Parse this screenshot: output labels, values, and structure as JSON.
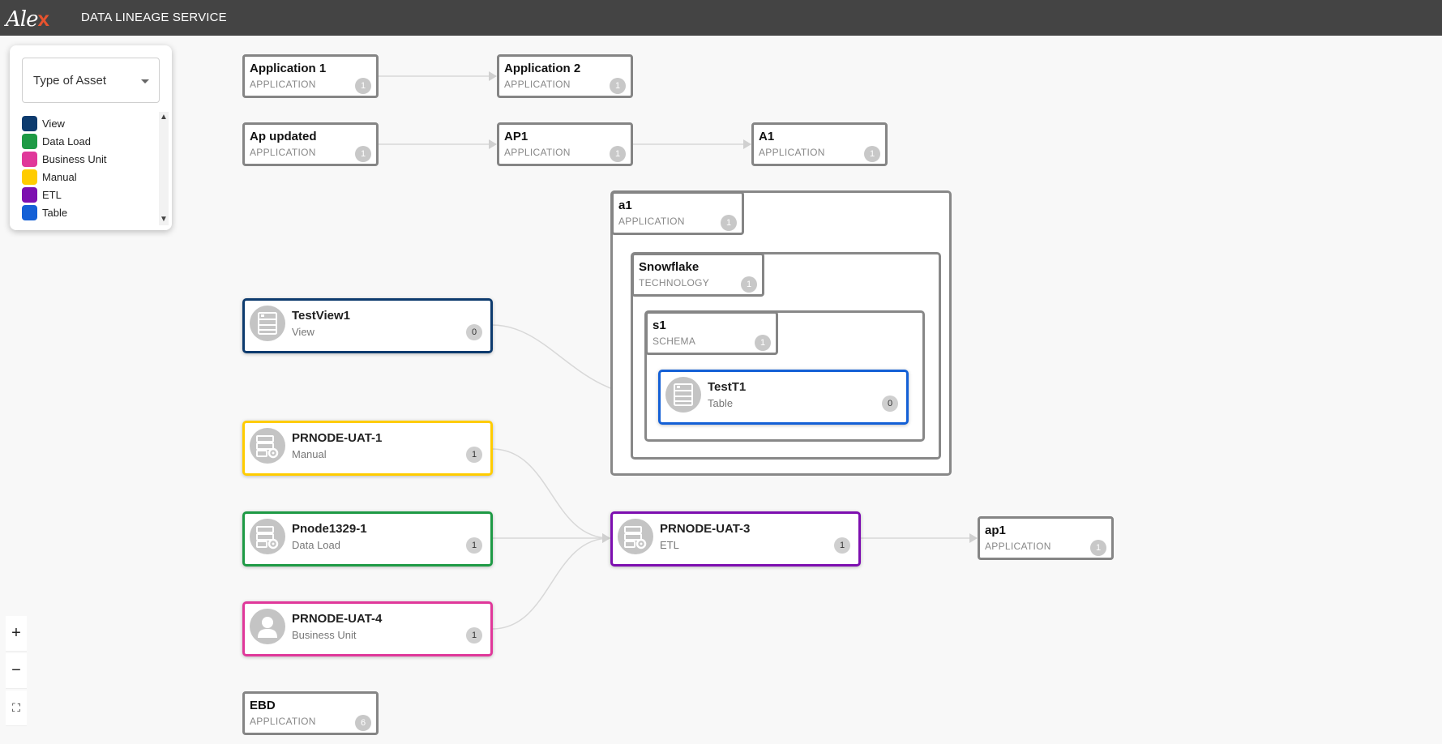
{
  "header": {
    "logo_text": "Ale",
    "logo_accent": "x",
    "title": "DATA LINEAGE SERVICE"
  },
  "legend": {
    "select_label": "Type of Asset",
    "items": [
      {
        "label": "View",
        "color": "#0d3b6e"
      },
      {
        "label": "Data Load",
        "color": "#1e9a45"
      },
      {
        "label": "Business Unit",
        "color": "#e0389a"
      },
      {
        "label": "Manual",
        "color": "#ffcc00"
      },
      {
        "label": "ETL",
        "color": "#7d0fb0"
      },
      {
        "label": "Table",
        "color": "#1460d6"
      }
    ]
  },
  "nodes": {
    "app1": {
      "title": "Application 1",
      "type": "APPLICATION",
      "count": "1"
    },
    "app2": {
      "title": "Application 2",
      "type": "APPLICATION",
      "count": "1"
    },
    "apupdated": {
      "title": "Ap updated",
      "type": "APPLICATION",
      "count": "1"
    },
    "ap1upper": {
      "title": "AP1",
      "type": "APPLICATION",
      "count": "1"
    },
    "a1upper": {
      "title": "A1",
      "type": "APPLICATION",
      "count": "1"
    },
    "a1": {
      "title": "a1",
      "type": "APPLICATION",
      "count": "1"
    },
    "snowflake": {
      "title": "Snowflake",
      "type": "TECHNOLOGY",
      "count": "1"
    },
    "s1": {
      "title": "s1",
      "type": "SCHEMA",
      "count": "1"
    },
    "ap1": {
      "title": "ap1",
      "type": "APPLICATION",
      "count": "1"
    },
    "ebd": {
      "title": "EBD",
      "type": "APPLICATION",
      "count": "6"
    }
  },
  "assets": {
    "testview1": {
      "title": "TestView1",
      "type": "View",
      "count": "0",
      "icon": "table-icon",
      "color": "#0d3b6e"
    },
    "testt1": {
      "title": "TestT1",
      "type": "Table",
      "count": "0",
      "icon": "table-icon",
      "color": "#1460d6"
    },
    "prnode_uat_1": {
      "title": "PRNODE-UAT-1",
      "type": "Manual",
      "count": "1",
      "icon": "server-gear-icon",
      "color": "#ffcc00"
    },
    "pnode1329_1": {
      "title": "Pnode1329-1",
      "type": "Data Load",
      "count": "1",
      "icon": "server-gear-icon",
      "color": "#1e9a45"
    },
    "prnode_uat_4": {
      "title": "PRNODE-UAT-4",
      "type": "Business Unit",
      "count": "1",
      "icon": "user-icon",
      "color": "#e0389a"
    },
    "prnode_uat_3": {
      "title": "PRNODE-UAT-3",
      "type": "ETL",
      "count": "1",
      "icon": "server-gear-icon",
      "color": "#7d0fb0"
    }
  },
  "zoom": {
    "in": "+",
    "out": "−",
    "fit": "⛶"
  }
}
